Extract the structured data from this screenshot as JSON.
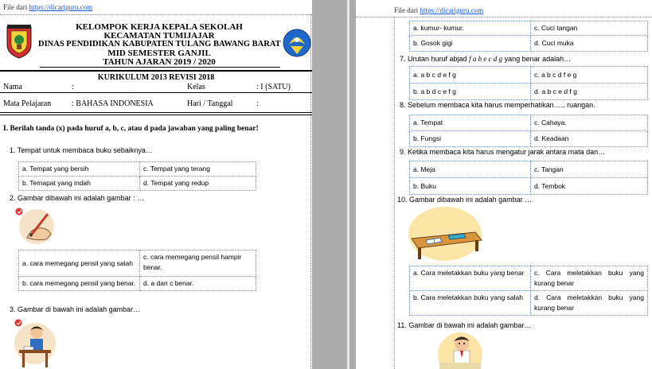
{
  "left": {
    "header_prefix": "File dari",
    "header_link": "https://dicariguru.com",
    "school_header": {
      "line1": "KELOMPOK KERJA KEPALA SEKOLAH",
      "line2": "KECAMATAN TUMIJAJAR",
      "line3": "DINAS PENDIDIKAN KABUPATEN TULANG BAWANG BARAT",
      "line4": "MID SEMESTER GANJIL",
      "line5": "TAHUN AJARAN 2019 / 2020"
    },
    "curriculum": "KURIKULUM 2013 REVISI 2018",
    "info": {
      "nama_label": "Nama",
      "nama_colon": ":",
      "kelas_label": "Kelas",
      "kelas_value": ": I (SATU)",
      "mapel_label": "Mata Pelajaran",
      "mapel_value": ": BAHASA INDONESIA",
      "hari_label": "Hari / Tanggal",
      "hari_colon": ":"
    },
    "instruction": "I. Berilah tanda (x) pada huruf a, b, c, atau d pada jawaban yang paling benar!",
    "questions": [
      {
        "text": "1.   Tempat untuk membaca buku sebaiknya…",
        "a": "a.  Tempat yang bersih",
        "b": "b.  Temapat yang indah",
        "c": "c.  Tempat yang terang",
        "d": "d.  Tempat yang redup"
      },
      {
        "text": "2.   Gambar dibawah ini adalah gambar : …",
        "a": "a.  cara memegang pensil yang salah",
        "b": "b.  cara memegang pensil yang benar.",
        "c": "c.  cara memegang pensil hampir benar.",
        "d": "d.  a dan c benar."
      },
      {
        "text": "3.   Gambar di bawah ini adalah gambar…"
      }
    ]
  },
  "right": {
    "header_prefix": "File dari",
    "header_link": "https://dicariguru.com",
    "q6_opts": {
      "a": "a.  kumur- kumur.",
      "b": "b.  Gosok gigi",
      "c": "c.  Cuci tangan",
      "d": "d.  Cuci muka"
    },
    "q7": {
      "text_pre": "7.   Urutan huruf abjad ",
      "text_em": "f a b e c d g",
      "text_post": " yang benar adalah…",
      "a": "a.  a b c d e f g",
      "b": "b.  a b d c e f g",
      "c": "c.  a b c d f e g",
      "d": "d.  a b c  e d f g"
    },
    "q8": {
      "text": "8.   Sebelum membaca kita harus memperhatikan….. ruangan.",
      "a": "a.  Tempat",
      "b": "b.  Fungsi",
      "c": "c.  Cahaya.",
      "d": "d.  Keadaan"
    },
    "q9": {
      "text": "9.   Ketika membaca kita harus mengatur jarak antara mata dan…",
      "a": "a.  Meja",
      "b": "b.  Buku",
      "c": "c.  Tangan",
      "d": "d.  Tembok"
    },
    "q10": {
      "text": "10. Gambar dibawah ini adalah gambar …",
      "a": "a.    Cara   meletakkan   buku  yang benar",
      "b": "b.    Cara   meletakkan   buku  yang salah",
      "c": "c.    Cara   meletakkan   buku  yang kurang  benar",
      "d": "d.    Cara   meletakkan   buku  yang kurang benar"
    },
    "q11": {
      "text": "11. Gambar di bawah ini adalah gambar…"
    }
  },
  "colors": {
    "link": "#1a5ad8",
    "table_border": "#6e8fbf",
    "background_gray": "#ababab"
  }
}
